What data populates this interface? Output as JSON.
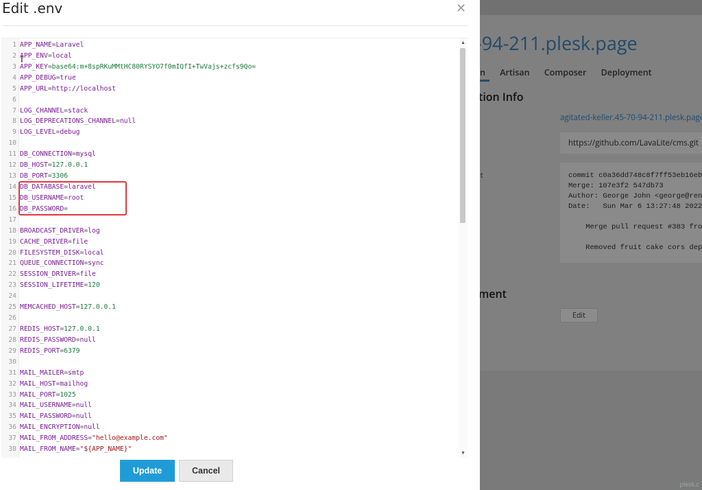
{
  "dialog": {
    "title": "Edit .env",
    "update_label": "Update",
    "cancel_label": "Cancel"
  },
  "editor": {
    "lines": [
      {
        "n": "1",
        "k": "APP_NAME",
        "v": "Laravel",
        "t": "val"
      },
      {
        "n": "2",
        "k": "APP_ENV",
        "v": "local",
        "t": "val"
      },
      {
        "n": "3",
        "k": "APP_KEY",
        "v": "base64:m+8spRKuMMtHC80RYSYO7f0mIQfI+TwVajs+zcfs9Qo=",
        "t": "num"
      },
      {
        "n": "4",
        "k": "APP_DEBUG",
        "v": "true",
        "t": "val"
      },
      {
        "n": "5",
        "k": "APP_URL",
        "v": "http://localhost",
        "t": "val"
      },
      {
        "n": "6",
        "k": "",
        "v": "",
        "t": ""
      },
      {
        "n": "7",
        "k": "LOG_CHANNEL",
        "v": "stack",
        "t": "val"
      },
      {
        "n": "8",
        "k": "LOG_DEPRECATIONS_CHANNEL",
        "v": "null",
        "t": "val"
      },
      {
        "n": "9",
        "k": "LOG_LEVEL",
        "v": "debug",
        "t": "val"
      },
      {
        "n": "10",
        "k": "",
        "v": "",
        "t": ""
      },
      {
        "n": "11",
        "k": "DB_CONNECTION",
        "v": "mysql",
        "t": "val"
      },
      {
        "n": "12",
        "k": "DB_HOST",
        "v": "127.0.0.1",
        "t": "num"
      },
      {
        "n": "13",
        "k": "DB_PORT",
        "v": "3306",
        "t": "num"
      },
      {
        "n": "14",
        "k": "DB_DATABASE",
        "v": "laravel",
        "t": "val"
      },
      {
        "n": "15",
        "k": "DB_USERNAME",
        "v": "root",
        "t": "val"
      },
      {
        "n": "16",
        "k": "DB_PASSWORD",
        "v": "",
        "t": "val"
      },
      {
        "n": "17",
        "k": "",
        "v": "",
        "t": ""
      },
      {
        "n": "18",
        "k": "BROADCAST_DRIVER",
        "v": "log",
        "t": "val"
      },
      {
        "n": "19",
        "k": "CACHE_DRIVER",
        "v": "file",
        "t": "val"
      },
      {
        "n": "20",
        "k": "FILESYSTEM_DISK",
        "v": "local",
        "t": "val"
      },
      {
        "n": "21",
        "k": "QUEUE_CONNECTION",
        "v": "sync",
        "t": "val"
      },
      {
        "n": "22",
        "k": "SESSION_DRIVER",
        "v": "file",
        "t": "val"
      },
      {
        "n": "23",
        "k": "SESSION_LIFETIME",
        "v": "120",
        "t": "num"
      },
      {
        "n": "24",
        "k": "",
        "v": "",
        "t": ""
      },
      {
        "n": "25",
        "k": "MEMCACHED_HOST",
        "v": "127.0.0.1",
        "t": "num"
      },
      {
        "n": "26",
        "k": "",
        "v": "",
        "t": ""
      },
      {
        "n": "27",
        "k": "REDIS_HOST",
        "v": "127.0.0.1",
        "t": "num"
      },
      {
        "n": "28",
        "k": "REDIS_PASSWORD",
        "v": "null",
        "t": "val"
      },
      {
        "n": "29",
        "k": "REDIS_PORT",
        "v": "6379",
        "t": "num"
      },
      {
        "n": "30",
        "k": "",
        "v": "",
        "t": ""
      },
      {
        "n": "31",
        "k": "MAIL_MAILER",
        "v": "smtp",
        "t": "val"
      },
      {
        "n": "32",
        "k": "MAIL_HOST",
        "v": "mailhog",
        "t": "val"
      },
      {
        "n": "33",
        "k": "MAIL_PORT",
        "v": "1025",
        "t": "num"
      },
      {
        "n": "34",
        "k": "MAIL_USERNAME",
        "v": "null",
        "t": "val"
      },
      {
        "n": "35",
        "k": "MAIL_PASSWORD",
        "v": "null",
        "t": "val"
      },
      {
        "n": "36",
        "k": "MAIL_ENCRYPTION",
        "v": "null",
        "t": "val"
      },
      {
        "n": "37",
        "k": "MAIL_FROM_ADDRESS",
        "v": "\"hello@example.com\"",
        "t": "str"
      },
      {
        "n": "38",
        "k": "MAIL_FROM_NAME",
        "v": "\"${APP_NAME}\"",
        "t": "str"
      }
    ]
  },
  "background": {
    "domain_fragment": "-94-211.plesk.page",
    "tabs": [
      "n",
      "Artisan",
      "Composer",
      "Deployment"
    ],
    "section_info": "tion Info",
    "site_link": "agitated-keller.45-70-94-211.plesk.page",
    "repo_url": "https://github.com/LavaLite/cms.git",
    "label_fragment": "it",
    "commit_text": "commit c0a36dd748c8f7ff53eb16eb5\nMerge: 107e3f2 547db73\nAuthor: George John <george@renf\nDate:   Sun Mar 6 13:27:48 2022\n\n    Merge pull request #383 from\n\n    Removed fruit cake cors depe",
    "section_deploy": "ment",
    "edit_label": "Edit",
    "footer": "plesk.c"
  },
  "colors": {
    "primary_button": "#1f9cd8",
    "highlight": "#e0383e",
    "key_color": "#7a1a96",
    "number_color": "#1a7a3a"
  }
}
